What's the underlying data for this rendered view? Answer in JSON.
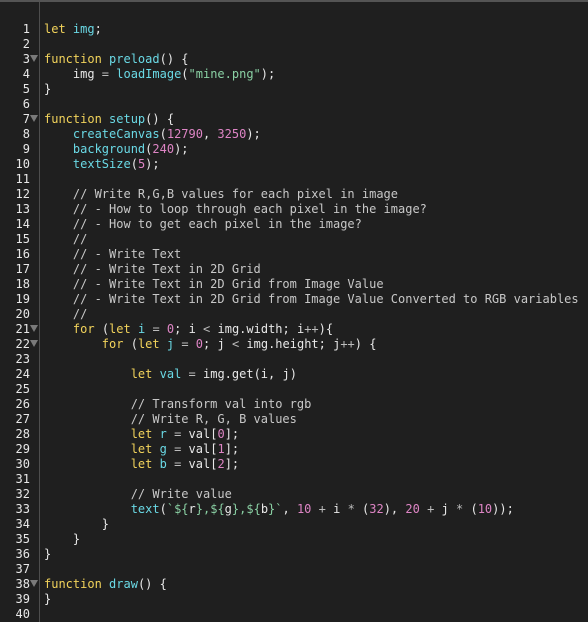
{
  "editor": {
    "language": "javascript",
    "foldable_lines": [
      3,
      7,
      21,
      22,
      38
    ],
    "colors": {
      "background": "#1f1f1f",
      "keyword": "#f2d35b",
      "function": "#6ad9e5",
      "number": "#de85c5",
      "string": "#8ad1a4",
      "comment": "#c8c8c8",
      "text": "#e8e8e8"
    },
    "lines": [
      {
        "n": "1",
        "tokens": [
          [
            "kw",
            "let"
          ],
          [
            "pl",
            " "
          ],
          [
            "var",
            "img"
          ],
          [
            "pl",
            ";"
          ]
        ]
      },
      {
        "n": "2",
        "tokens": []
      },
      {
        "n": "3",
        "tokens": [
          [
            "kw",
            "function"
          ],
          [
            "pl",
            " "
          ],
          [
            "fn",
            "preload"
          ],
          [
            "pl",
            "() {"
          ]
        ]
      },
      {
        "n": "4",
        "tokens": [
          [
            "pl",
            "    img "
          ],
          [
            "op",
            "="
          ],
          [
            "pl",
            " "
          ],
          [
            "fn",
            "loadImage"
          ],
          [
            "pl",
            "("
          ],
          [
            "str",
            "\"mine.png\""
          ],
          [
            "pl",
            ");"
          ]
        ]
      },
      {
        "n": "5",
        "tokens": [
          [
            "pl",
            "}"
          ]
        ]
      },
      {
        "n": "6",
        "tokens": []
      },
      {
        "n": "7",
        "tokens": [
          [
            "kw",
            "function"
          ],
          [
            "pl",
            " "
          ],
          [
            "fn",
            "setup"
          ],
          [
            "pl",
            "() {"
          ]
        ]
      },
      {
        "n": "8",
        "tokens": [
          [
            "pl",
            "    "
          ],
          [
            "fn",
            "createCanvas"
          ],
          [
            "pl",
            "("
          ],
          [
            "num",
            "12790"
          ],
          [
            "pl",
            ", "
          ],
          [
            "num",
            "3250"
          ],
          [
            "pl",
            ");"
          ]
        ]
      },
      {
        "n": "9",
        "tokens": [
          [
            "pl",
            "    "
          ],
          [
            "fn",
            "background"
          ],
          [
            "pl",
            "("
          ],
          [
            "num",
            "240"
          ],
          [
            "pl",
            ");"
          ]
        ]
      },
      {
        "n": "10",
        "tokens": [
          [
            "pl",
            "    "
          ],
          [
            "fn",
            "textSize"
          ],
          [
            "pl",
            "("
          ],
          [
            "num",
            "5"
          ],
          [
            "pl",
            ");"
          ]
        ]
      },
      {
        "n": "11",
        "tokens": []
      },
      {
        "n": "12",
        "tokens": [
          [
            "cm",
            "    // Write R,G,B values for each pixel in image"
          ]
        ]
      },
      {
        "n": "13",
        "tokens": [
          [
            "cm",
            "    // - How to loop through each pixel in the image?"
          ]
        ]
      },
      {
        "n": "14",
        "tokens": [
          [
            "cm",
            "    // - How to get each pixel in the image?"
          ]
        ]
      },
      {
        "n": "15",
        "tokens": [
          [
            "cm",
            "    //"
          ]
        ]
      },
      {
        "n": "16",
        "tokens": [
          [
            "cm",
            "    // - Write Text"
          ]
        ]
      },
      {
        "n": "17",
        "tokens": [
          [
            "cm",
            "    // - Write Text in 2D Grid"
          ]
        ]
      },
      {
        "n": "18",
        "tokens": [
          [
            "cm",
            "    // - Write Text in 2D Grid from Image Value"
          ]
        ]
      },
      {
        "n": "19",
        "tokens": [
          [
            "cm",
            "    // - Write Text in 2D Grid from Image Value Converted to RGB variables"
          ]
        ]
      },
      {
        "n": "20",
        "tokens": [
          [
            "cm",
            "    //"
          ]
        ]
      },
      {
        "n": "21",
        "tokens": [
          [
            "pl",
            "    "
          ],
          [
            "kw",
            "for"
          ],
          [
            "pl",
            " ("
          ],
          [
            "kw",
            "let"
          ],
          [
            "pl",
            " "
          ],
          [
            "var",
            "i"
          ],
          [
            "pl",
            " "
          ],
          [
            "op",
            "="
          ],
          [
            "pl",
            " "
          ],
          [
            "num",
            "0"
          ],
          [
            "pl",
            "; i "
          ],
          [
            "op",
            "<"
          ],
          [
            "pl",
            " img.width; i"
          ],
          [
            "op",
            "++"
          ],
          [
            "pl",
            "){"
          ]
        ]
      },
      {
        "n": "22",
        "tokens": [
          [
            "pl",
            "        "
          ],
          [
            "kw",
            "for"
          ],
          [
            "pl",
            " ("
          ],
          [
            "kw",
            "let"
          ],
          [
            "pl",
            " "
          ],
          [
            "var",
            "j"
          ],
          [
            "pl",
            " "
          ],
          [
            "op",
            "="
          ],
          [
            "pl",
            " "
          ],
          [
            "num",
            "0"
          ],
          [
            "pl",
            "; j "
          ],
          [
            "op",
            "<"
          ],
          [
            "pl",
            " img.height; j"
          ],
          [
            "op",
            "++"
          ],
          [
            "pl",
            ") {"
          ]
        ]
      },
      {
        "n": "23",
        "tokens": []
      },
      {
        "n": "24",
        "tokens": [
          [
            "pl",
            "            "
          ],
          [
            "kw",
            "let"
          ],
          [
            "pl",
            " "
          ],
          [
            "var",
            "val"
          ],
          [
            "pl",
            " "
          ],
          [
            "op",
            "="
          ],
          [
            "pl",
            " img.get(i, j)"
          ]
        ]
      },
      {
        "n": "25",
        "tokens": []
      },
      {
        "n": "26",
        "tokens": [
          [
            "cm",
            "            // Transform val into rgb"
          ]
        ]
      },
      {
        "n": "27",
        "tokens": [
          [
            "cm",
            "            // Write R, G, B values"
          ]
        ]
      },
      {
        "n": "28",
        "tokens": [
          [
            "pl",
            "            "
          ],
          [
            "kw",
            "let"
          ],
          [
            "pl",
            " "
          ],
          [
            "var",
            "r"
          ],
          [
            "pl",
            " "
          ],
          [
            "op",
            "="
          ],
          [
            "pl",
            " val["
          ],
          [
            "num",
            "0"
          ],
          [
            "pl",
            "];"
          ]
        ]
      },
      {
        "n": "29",
        "tokens": [
          [
            "pl",
            "            "
          ],
          [
            "kw",
            "let"
          ],
          [
            "pl",
            " "
          ],
          [
            "var",
            "g"
          ],
          [
            "pl",
            " "
          ],
          [
            "op",
            "="
          ],
          [
            "pl",
            " val["
          ],
          [
            "num",
            "1"
          ],
          [
            "pl",
            "];"
          ]
        ]
      },
      {
        "n": "30",
        "tokens": [
          [
            "pl",
            "            "
          ],
          [
            "kw",
            "let"
          ],
          [
            "pl",
            " "
          ],
          [
            "var",
            "b"
          ],
          [
            "pl",
            " "
          ],
          [
            "op",
            "="
          ],
          [
            "pl",
            " val["
          ],
          [
            "num",
            "2"
          ],
          [
            "pl",
            "];"
          ]
        ]
      },
      {
        "n": "31",
        "tokens": []
      },
      {
        "n": "32",
        "tokens": [
          [
            "cm",
            "            // Write value"
          ]
        ]
      },
      {
        "n": "33",
        "tokens": [
          [
            "pl",
            "            "
          ],
          [
            "fn",
            "text"
          ],
          [
            "pl",
            "("
          ],
          [
            "str",
            "`${"
          ],
          [
            "pl",
            "r"
          ],
          [
            "str",
            "},${"
          ],
          [
            "pl",
            "g"
          ],
          [
            "str",
            "},${"
          ],
          [
            "pl",
            "b"
          ],
          [
            "str",
            "}`"
          ],
          [
            "pl",
            ", "
          ],
          [
            "num",
            "10"
          ],
          [
            "pl",
            " "
          ],
          [
            "op",
            "+"
          ],
          [
            "pl",
            " i "
          ],
          [
            "op",
            "*"
          ],
          [
            "pl",
            " ("
          ],
          [
            "num",
            "32"
          ],
          [
            "pl",
            "), "
          ],
          [
            "num",
            "20"
          ],
          [
            "pl",
            " "
          ],
          [
            "op",
            "+"
          ],
          [
            "pl",
            " j "
          ],
          [
            "op",
            "*"
          ],
          [
            "pl",
            " ("
          ],
          [
            "num",
            "10"
          ],
          [
            "pl",
            "));"
          ]
        ]
      },
      {
        "n": "34",
        "tokens": [
          [
            "pl",
            "        }"
          ]
        ]
      },
      {
        "n": "35",
        "tokens": [
          [
            "pl",
            "    }"
          ]
        ]
      },
      {
        "n": "36",
        "tokens": [
          [
            "pl",
            "}"
          ]
        ]
      },
      {
        "n": "37",
        "tokens": []
      },
      {
        "n": "38",
        "tokens": [
          [
            "kw",
            "function"
          ],
          [
            "pl",
            " "
          ],
          [
            "fn",
            "draw"
          ],
          [
            "pl",
            "() {"
          ]
        ]
      },
      {
        "n": "39",
        "tokens": [
          [
            "pl",
            "}"
          ]
        ]
      },
      {
        "n": "40",
        "tokens": []
      }
    ]
  }
}
